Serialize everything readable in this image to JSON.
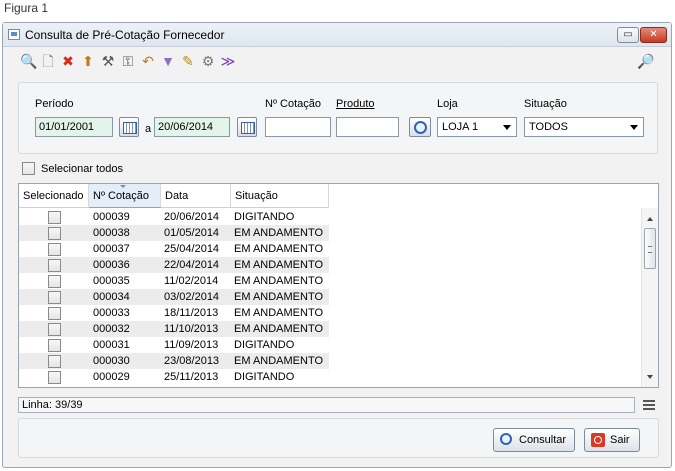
{
  "caption": "Figura 1",
  "window": {
    "title": "Consulta de Pré-Cotação Fornecedor",
    "minimize_label": "▭",
    "close_label": "✕"
  },
  "toolbar": {
    "icons": [
      {
        "name": "search-icon",
        "glyph": "🔍",
        "color": "#2d64b8"
      },
      {
        "name": "new-document-icon",
        "glyph": "🗋",
        "color": "#777777"
      },
      {
        "name": "delete-icon",
        "glyph": "✖",
        "color": "#d82a1a"
      },
      {
        "name": "export-icon",
        "glyph": "⬆",
        "color": "#c07a1a"
      },
      {
        "name": "tools-icon",
        "glyph": "⚒",
        "color": "#555555"
      },
      {
        "name": "key-icon",
        "glyph": "⚿",
        "color": "#555555"
      },
      {
        "name": "undo-icon",
        "glyph": "↶",
        "color": "#c07a1a"
      },
      {
        "name": "filter-icon",
        "glyph": "▼",
        "color": "#8a6fc9"
      },
      {
        "name": "edit-icon",
        "glyph": "✎",
        "color": "#b58a1a"
      },
      {
        "name": "settings-icon",
        "glyph": "⚙",
        "color": "#777777"
      },
      {
        "name": "forward-icon",
        "glyph": "≫",
        "color": "#7a3fb0"
      }
    ],
    "help_glyph": "🔎"
  },
  "filters": {
    "periodo_label": "Período",
    "date_from": "01/01/2001",
    "a_label": "a",
    "date_to": "20/06/2014",
    "cotacao_label": "Nº Cotação",
    "cotacao_value": "",
    "produto_label": "Produto",
    "produto_value": "",
    "loja_label": "Loja",
    "loja_value": "LOJA 1",
    "situacao_label": "Situação",
    "situacao_value": "TODOS"
  },
  "select_all_label": "Selecionar todos",
  "grid": {
    "columns": [
      "Selecionado",
      "Nº Cotação",
      "Data",
      "Situação"
    ],
    "rows": [
      {
        "cotacao": "000039",
        "data": "20/06/2014",
        "situacao": "DIGITANDO"
      },
      {
        "cotacao": "000038",
        "data": "01/05/2014",
        "situacao": "EM ANDAMENTO"
      },
      {
        "cotacao": "000037",
        "data": "25/04/2014",
        "situacao": "EM ANDAMENTO"
      },
      {
        "cotacao": "000036",
        "data": "22/04/2014",
        "situacao": "EM ANDAMENTO"
      },
      {
        "cotacao": "000035",
        "data": "11/02/2014",
        "situacao": "EM ANDAMENTO"
      },
      {
        "cotacao": "000034",
        "data": "03/02/2014",
        "situacao": "EM ANDAMENTO"
      },
      {
        "cotacao": "000033",
        "data": "18/11/2013",
        "situacao": "EM ANDAMENTO"
      },
      {
        "cotacao": "000032",
        "data": "11/10/2013",
        "situacao": "EM ANDAMENTO"
      },
      {
        "cotacao": "000031",
        "data": "11/09/2013",
        "situacao": "DIGITANDO"
      },
      {
        "cotacao": "000030",
        "data": "23/08/2013",
        "situacao": "EM ANDAMENTO"
      },
      {
        "cotacao": "000029",
        "data": "25/11/2013",
        "situacao": "DIGITANDO"
      }
    ]
  },
  "status_text": "Linha: 39/39",
  "buttons": {
    "consultar": "Consultar",
    "sair": "Sair"
  }
}
